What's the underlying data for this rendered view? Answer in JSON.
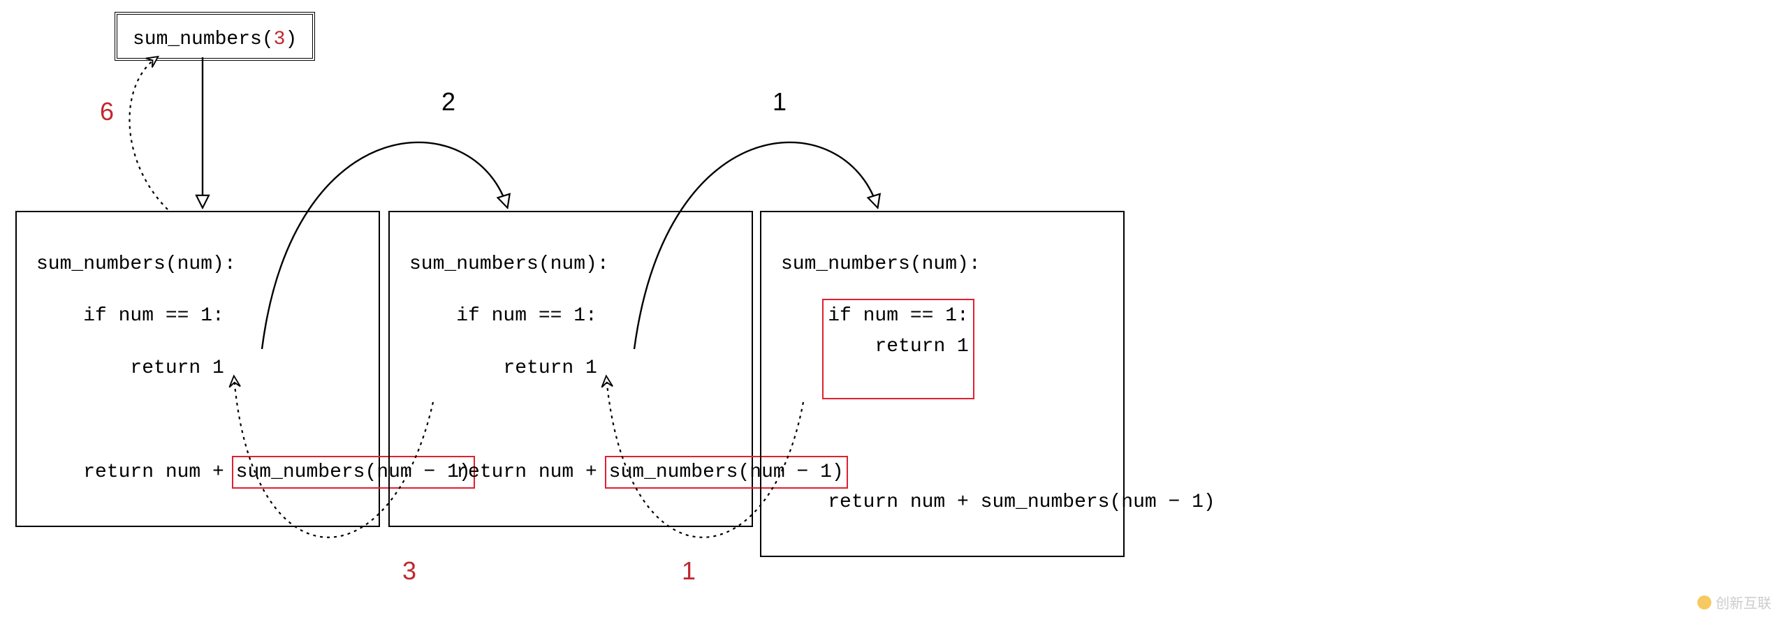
{
  "entry": {
    "fn": "sum_numbers",
    "arg": "3"
  },
  "calls": {
    "forward": [
      "2",
      "1"
    ],
    "returns": [
      "6",
      "3",
      "1"
    ]
  },
  "code": {
    "l1": "sum_numbers(num):",
    "l2": "    if num == 1:",
    "l2b": "if num == 1:",
    "l3": "        return 1",
    "l3b": "return 1",
    "l4a": "    return num + ",
    "l4b": "sum_numbers(num − 1)",
    "l4a_nosp": "return num + ",
    "l4full": "    return num + sum_numbers(num − 1)"
  },
  "watermark": "创新互联"
}
